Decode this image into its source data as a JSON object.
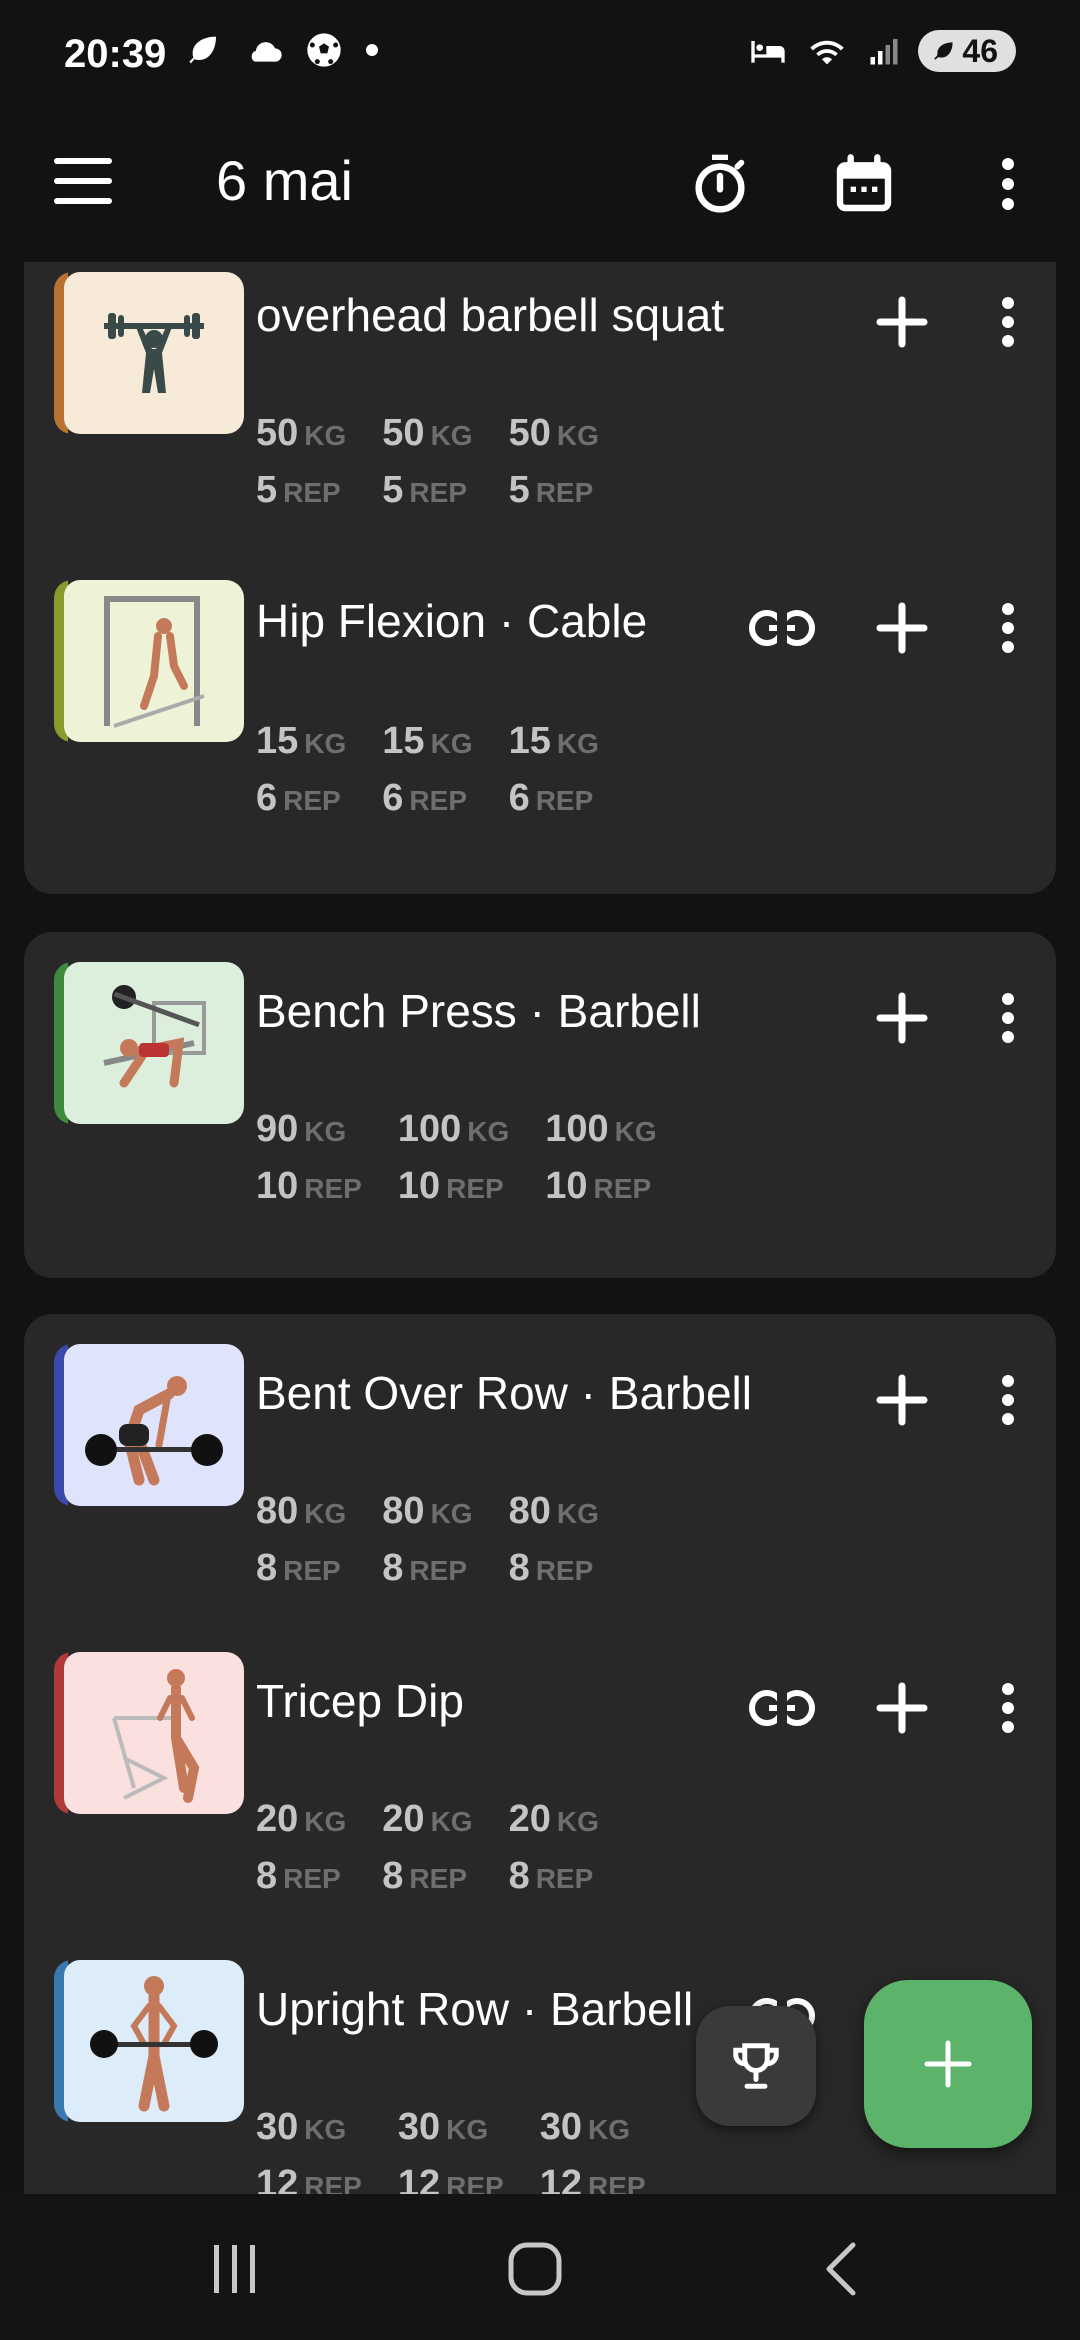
{
  "status_bar": {
    "time": "20:39",
    "left_icons": [
      "leaf-icon",
      "cloud-icon",
      "soccer-ball-icon",
      "dot-icon"
    ],
    "right_icons": [
      "bed-icon",
      "wifi-icon",
      "signal-icon"
    ],
    "battery": "46"
  },
  "app_bar": {
    "title": "6 mai",
    "icons": [
      "menu-icon",
      "timer-icon",
      "calendar-icon",
      "more-vertical-icon"
    ]
  },
  "cards": [
    {
      "exercises": [
        {
          "name": "overhead barbell squat",
          "accent": "#b87333",
          "thumb_bg": "#f7ead8",
          "linked": false,
          "sets": [
            {
              "weight": "50",
              "reps": "5"
            },
            {
              "weight": "50",
              "reps": "5"
            },
            {
              "weight": "50",
              "reps": "5"
            }
          ]
        },
        {
          "name": "Hip Flexion · Cable",
          "accent": "#8a9a2e",
          "thumb_bg": "#eef3d8",
          "linked": true,
          "sets": [
            {
              "weight": "15",
              "reps": "6"
            },
            {
              "weight": "15",
              "reps": "6"
            },
            {
              "weight": "15",
              "reps": "6"
            }
          ]
        }
      ]
    },
    {
      "exercises": [
        {
          "name": "Bench Press · Barbell",
          "accent": "#3e8a3e",
          "thumb_bg": "#dcefdc",
          "linked": false,
          "sets": [
            {
              "weight": "90",
              "reps": "10"
            },
            {
              "weight": "100",
              "reps": "10"
            },
            {
              "weight": "100",
              "reps": "10"
            }
          ]
        }
      ]
    },
    {
      "exercises": [
        {
          "name": "Bent Over Row · Barbell",
          "accent": "#3a4aa8",
          "thumb_bg": "#dfe3fb",
          "linked": false,
          "sets": [
            {
              "weight": "80",
              "reps": "8"
            },
            {
              "weight": "80",
              "reps": "8"
            },
            {
              "weight": "80",
              "reps": "8"
            }
          ]
        },
        {
          "name": "Tricep Dip",
          "accent": "#b03a3a",
          "thumb_bg": "#fbe0e0",
          "linked": true,
          "sets": [
            {
              "weight": "20",
              "reps": "8"
            },
            {
              "weight": "20",
              "reps": "8"
            },
            {
              "weight": "20",
              "reps": "8"
            }
          ]
        },
        {
          "name": "Upright Row · Barbell",
          "accent": "#3a78b0",
          "thumb_bg": "#dcecf8",
          "linked": true,
          "sets": [
            {
              "weight": "30",
              "reps": "12"
            },
            {
              "weight": "30",
              "reps": "12"
            },
            {
              "weight": "30",
              "reps": "12"
            }
          ]
        }
      ]
    }
  ],
  "units": {
    "weight": "KG",
    "reps": "REP"
  },
  "fab": {
    "trophy_icon": "trophy-icon",
    "add_icon": "add-icon",
    "color": "#5cb36a"
  },
  "nav_bar": {
    "icons": [
      "recent-apps-icon",
      "home-icon",
      "back-icon"
    ]
  }
}
